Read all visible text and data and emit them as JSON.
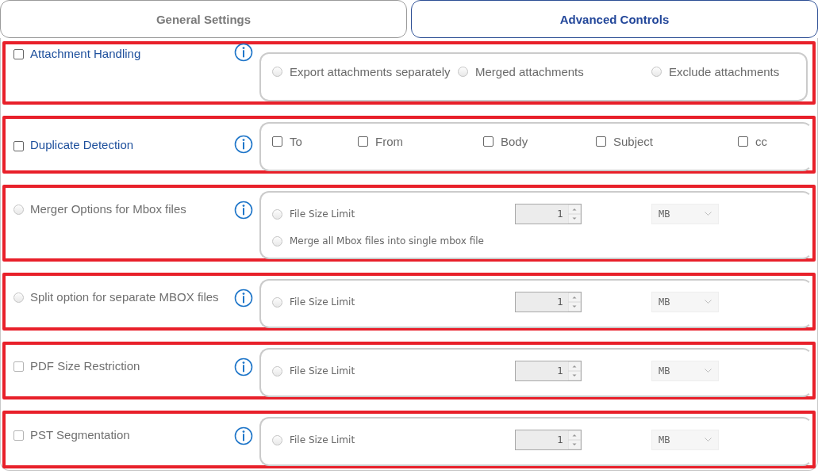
{
  "tabs": [
    {
      "label": "General Settings",
      "selected": false
    },
    {
      "label": "Advanced Controls",
      "selected": true
    }
  ],
  "sections": [
    {
      "kind": "checkbox",
      "checked": false,
      "label": "Attachment Handling",
      "active": true,
      "highlighted": true,
      "options": [
        {
          "kind": "radio",
          "label": "Export attachments separately",
          "selected": false
        },
        {
          "kind": "radio",
          "label": "Merged attachments",
          "selected": false
        },
        {
          "kind": "radio",
          "label": "Exclude attachments",
          "selected": false
        }
      ]
    },
    {
      "kind": "checkbox",
      "checked": false,
      "label": "Duplicate Detection",
      "active": true,
      "highlighted": true,
      "options": [
        {
          "kind": "checkbox",
          "label": "To",
          "checked": false
        },
        {
          "kind": "checkbox",
          "label": "From",
          "checked": false
        },
        {
          "kind": "checkbox",
          "label": "Body",
          "checked": false
        },
        {
          "kind": "checkbox",
          "label": "Subject",
          "checked": false
        },
        {
          "kind": "checkbox",
          "label": "cc",
          "checked": false
        }
      ]
    },
    {
      "kind": "radio",
      "checked": false,
      "label": "Merger Options for Mbox files",
      "active": false,
      "highlighted": true,
      "options": [
        {
          "kind": "size",
          "label": "File Size Limit",
          "selected": false,
          "value": "1",
          "unit": "MB"
        },
        {
          "kind": "small-radio",
          "label": "Merge all Mbox files into single mbox file",
          "selected": false
        }
      ]
    },
    {
      "kind": "radio",
      "checked": false,
      "label": "Split option for separate MBOX files",
      "active": false,
      "highlighted": true,
      "options": [
        {
          "kind": "size",
          "label": "File Size Limit",
          "selected": false,
          "value": "1",
          "unit": "MB"
        }
      ]
    },
    {
      "kind": "checkbox",
      "checked": false,
      "label": "PDF Size Restriction",
      "active": false,
      "highlighted": true,
      "options": [
        {
          "kind": "size",
          "label": "File Size Limit",
          "selected": false,
          "value": "1",
          "unit": "MB"
        }
      ]
    },
    {
      "kind": "checkbox",
      "checked": false,
      "label": "PST Segmentation",
      "active": false,
      "highlighted": true,
      "options": [
        {
          "kind": "size",
          "label": "File Size Limit",
          "selected": false,
          "value": "1",
          "unit": "MB"
        }
      ]
    }
  ]
}
